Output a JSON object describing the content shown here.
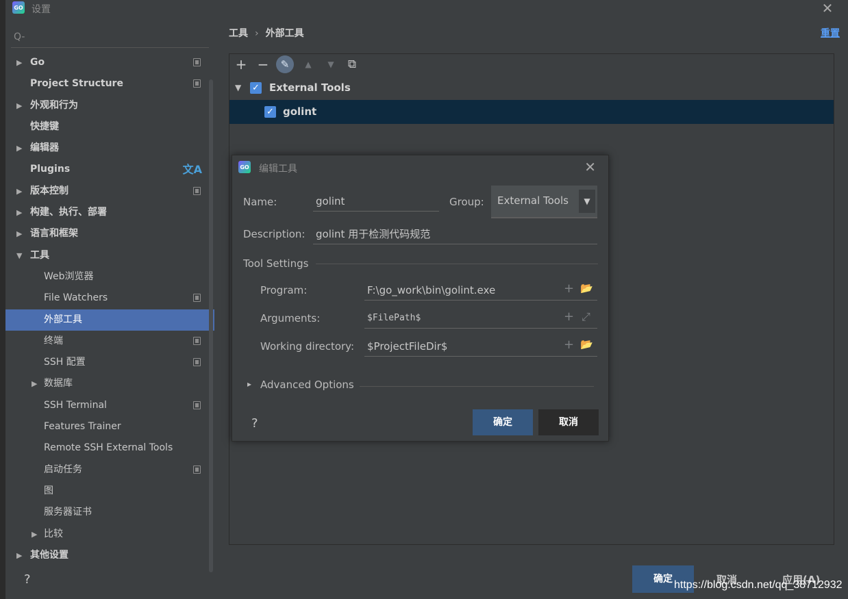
{
  "window": {
    "title": "设置"
  },
  "sidebar": {
    "search_placeholder": "Q-",
    "items": [
      {
        "label": "Go",
        "arrow": "▶",
        "level": 0,
        "marker": true
      },
      {
        "label": "Project Structure",
        "arrow": "",
        "level": 0,
        "marker": true
      },
      {
        "label": "外观和行为",
        "arrow": "▶",
        "level": 0,
        "marker": false
      },
      {
        "label": "快捷键",
        "arrow": "",
        "level": 0,
        "marker": false
      },
      {
        "label": "编辑器",
        "arrow": "▶",
        "level": 0,
        "marker": false
      },
      {
        "label": "Plugins",
        "arrow": "",
        "level": 0,
        "marker": false,
        "translate": true
      },
      {
        "label": "版本控制",
        "arrow": "▶",
        "level": 0,
        "marker": true
      },
      {
        "label": "构建、执行、部署",
        "arrow": "▶",
        "level": 0,
        "marker": false
      },
      {
        "label": "语言和框架",
        "arrow": "▶",
        "level": 0,
        "marker": false
      },
      {
        "label": "工具",
        "arrow": "▼",
        "level": 0,
        "marker": false
      },
      {
        "label": "Web浏览器",
        "arrow": "",
        "level": 1,
        "marker": false
      },
      {
        "label": "File Watchers",
        "arrow": "",
        "level": 1,
        "marker": true
      },
      {
        "label": "外部工具",
        "arrow": "",
        "level": 1,
        "marker": false,
        "selected": true
      },
      {
        "label": "终端",
        "arrow": "",
        "level": 1,
        "marker": true
      },
      {
        "label": "SSH 配置",
        "arrow": "",
        "level": 1,
        "marker": true
      },
      {
        "label": "数据库",
        "arrow": "▶",
        "level": 1,
        "marker": false
      },
      {
        "label": "SSH Terminal",
        "arrow": "",
        "level": 1,
        "marker": true
      },
      {
        "label": "Features Trainer",
        "arrow": "",
        "level": 1,
        "marker": false
      },
      {
        "label": "Remote SSH External Tools",
        "arrow": "",
        "level": 1,
        "marker": false
      },
      {
        "label": "启动任务",
        "arrow": "",
        "level": 1,
        "marker": true
      },
      {
        "label": "图",
        "arrow": "",
        "level": 1,
        "marker": false
      },
      {
        "label": "服务器证书",
        "arrow": "",
        "level": 1,
        "marker": false
      },
      {
        "label": "比较",
        "arrow": "▶",
        "level": 1,
        "marker": false
      },
      {
        "label": "其他设置",
        "arrow": "▶",
        "level": 0,
        "marker": false
      }
    ],
    "translate_glyph": "文A"
  },
  "header": {
    "crumb1": "工具",
    "separator": "›",
    "crumb2": "外部工具",
    "reset": "重置"
  },
  "toolbar": {
    "add": "+",
    "remove": "−",
    "edit": "✎",
    "up": "▲",
    "down": "▼",
    "copy": "⧉"
  },
  "tools_tree": {
    "group": {
      "label": "External Tools",
      "arrow": "▼",
      "checked": "✓"
    },
    "item": {
      "label": "golint",
      "checked": "✓"
    }
  },
  "dialog": {
    "title": "编辑工具",
    "close": "✕",
    "name_label": "Name:",
    "name_value": "golint",
    "group_label": "Group:",
    "group_value": "External Tools",
    "group_arrow": "▼",
    "description_label": "Description:",
    "description_value": "golint 用于检测代码规范",
    "tool_settings": "Tool Settings",
    "program_label": "Program:",
    "program_value": "F:\\go_work\\bin\\golint.exe",
    "arguments_label": "Arguments:",
    "arguments_value": "$FilePath$",
    "workdir_label": "Working directory:",
    "workdir_value": "$ProjectFileDir$",
    "advanced_arrow": "▸",
    "advanced": "Advanced Options",
    "help": "?",
    "ok": "确定",
    "cancel": "取消",
    "plus": "+",
    "folder": "📂",
    "expand": "⤢"
  },
  "bottom": {
    "help": "?",
    "ok": "确定",
    "cancel": "取消",
    "apply": "应用(A)",
    "watermark": "https://blog.csdn.net/qq_38712932"
  }
}
